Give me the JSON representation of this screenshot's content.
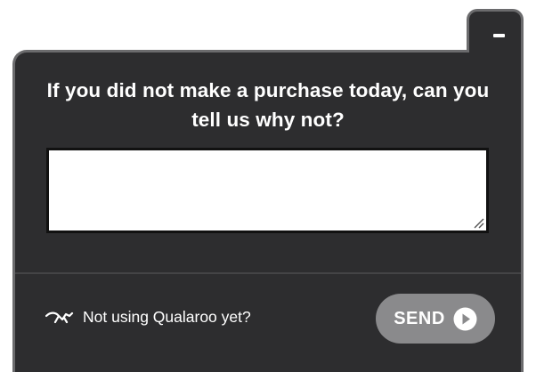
{
  "survey": {
    "question": "If you did not make a purchase today, can you tell us why not?",
    "answer_value": "",
    "minimize_icon": "minus-icon"
  },
  "footer": {
    "branding_text": "Not using Qualaroo yet?",
    "branding_icon": "qualaroo-logo-icon",
    "send_label": "SEND",
    "send_icon": "play-circle-icon"
  },
  "colors": {
    "panel_bg": "#2d2d2f",
    "panel_border": "#6b6b6d",
    "send_button": "#8a8a8c",
    "text": "#ffffff"
  }
}
